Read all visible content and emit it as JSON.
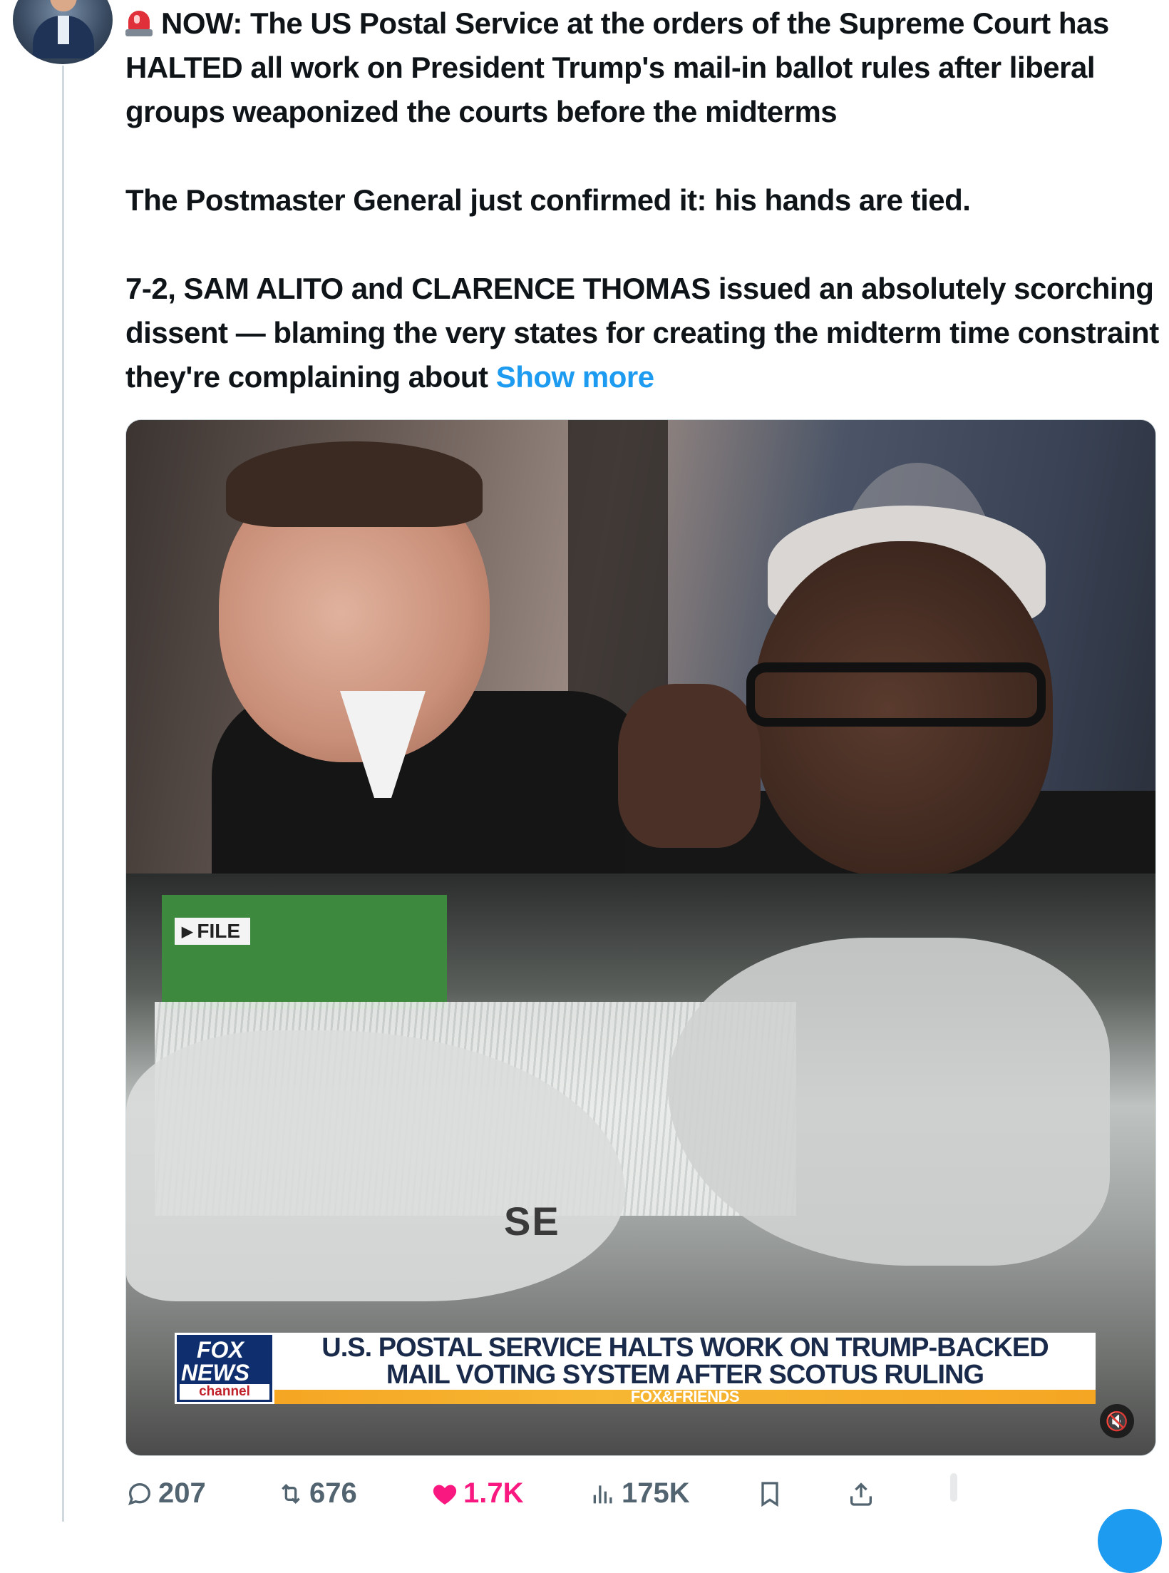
{
  "tweet": {
    "paragraphs": [
      "NOW: The US Postal Service at the orders of the Supreme Court has HALTED all work on President Trump's mail-in ballot rules after liberal groups weaponized the courts before the midterms",
      "The Postmaster General just confirmed it: his hands are tied.",
      "7-2, SAM ALITO and CLARENCE THOMAS issued an absolutely scorching dissent — blaming the very states for creating the midterm time constraint they're complaining about"
    ],
    "show_more": "Show more",
    "emoji_icon": "rotating-light-icon"
  },
  "media": {
    "file_tag": "FILE",
    "ballot_partial": "SE",
    "chyron_line1": "U.S. POSTAL SERVICE HALTS WORK ON TRUMP-BACKED",
    "chyron_line2": "MAIL VOTING SYSTEM AFTER SCOTUS RULING",
    "chyron_show": "FOX&FRIENDS",
    "logo_fox": "FOX",
    "logo_news": "NEWS",
    "logo_channel": "channel",
    "mute_icon": "mute-icon"
  },
  "actions": {
    "replies": "207",
    "reposts": "676",
    "likes": "1.7K",
    "views": "175K"
  },
  "colors": {
    "accent": "#1d9bf0",
    "like": "#f91880",
    "muted": "#536471"
  }
}
